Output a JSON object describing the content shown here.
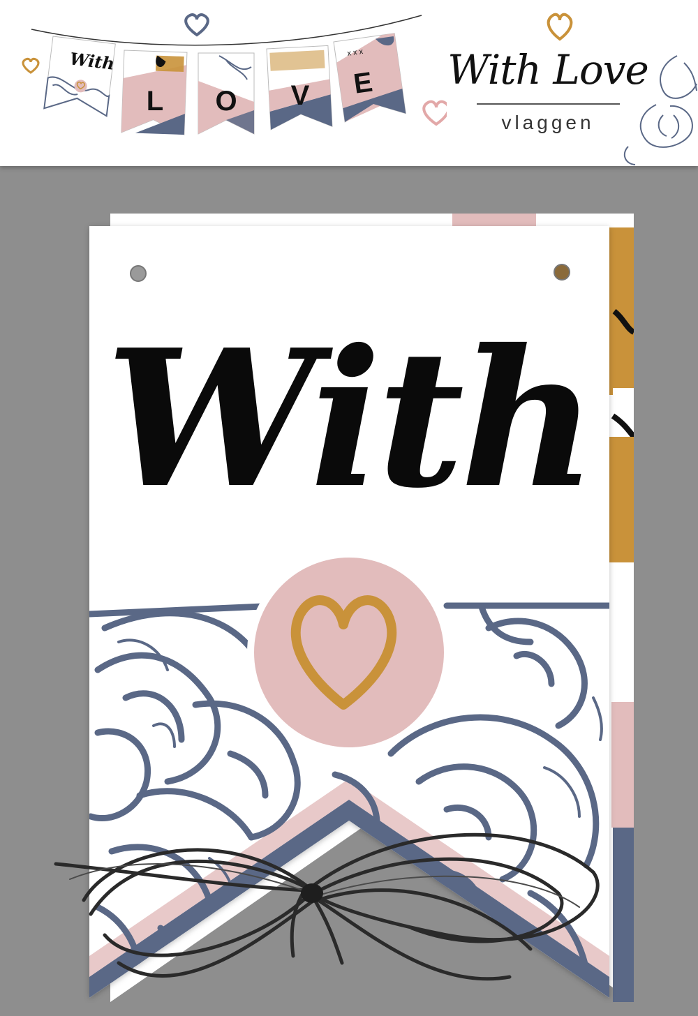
{
  "brand": {
    "title": "With Love",
    "subtitle": "vlaggen"
  },
  "bunting": {
    "flags": [
      {
        "text": "With"
      },
      {
        "text": "L"
      },
      {
        "text": "O"
      },
      {
        "text": "V"
      },
      {
        "text": "E"
      }
    ],
    "crosses": "x x x"
  },
  "main_flag": {
    "text": "With",
    "heart_icon": "heart-icon"
  },
  "colors": {
    "navy": "#5a6886",
    "pink": "#e2bcbc",
    "gold": "#c9923a",
    "black": "#0a0a0a",
    "background": "#8e8e8e"
  }
}
